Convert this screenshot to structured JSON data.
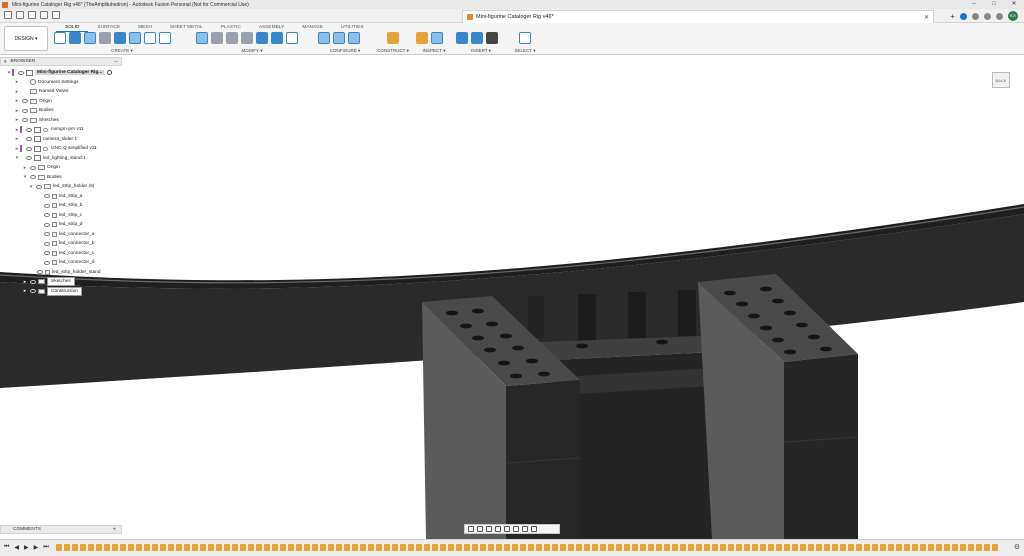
{
  "window": {
    "title": "Mini-figurine Cataloger Rig v46* (TheAmplituhedron) - Autodesk Fusion Personal (Not for Commercial Use)",
    "controls": [
      "–",
      "□",
      "✕"
    ]
  },
  "document_tab": {
    "title": "Mini-figurine Cataloger Rig v46*",
    "close": "✕"
  },
  "user": {
    "initials": "KA"
  },
  "workspace": {
    "label": "DESIGN ▾"
  },
  "ribbon": {
    "tabs": [
      "SOLID",
      "SURFACE",
      "MESH",
      "SHEET METAL",
      "PLASTIC",
      "ASSEMBLY",
      "MANAGE",
      "UTILITIES"
    ],
    "active_tab": "SOLID",
    "groups": [
      "CREATE ▾",
      "MODIFY ▾",
      "CONFIGURE ▾",
      "CONSTRUCT ▾",
      "INSPECT ▾",
      "INSERT ▾",
      "SELECT ▾"
    ]
  },
  "browser": {
    "title": "BROWSER",
    "root": "Mini-figurine Cataloger Rig...",
    "items": [
      "Document Settings",
      "Named Views",
      "Origin",
      "Bodies",
      "Sketches",
      "mimgm-pm v11",
      "camera_slider:1",
      "UNO Q simplified v11",
      "led_lighting_stand:1",
      "Origin",
      "Bodies",
      "led_strip_holder (8)",
      "led_strip_a",
      "led_strip_b",
      "led_strip_c",
      "led_strip_d",
      "led_connector_a",
      "led_connector_b",
      "led_connector_c",
      "led_connector_d",
      "led_strip_holder_stand",
      "Sketches",
      "Construction"
    ]
  },
  "viewcube": {
    "face": "BACK"
  },
  "comments": {
    "title": "COMMENTS",
    "add": "+"
  },
  "colors": {
    "accent": "#1e72c8",
    "body_dark": "#2b2b2b",
    "body_grey": "#5c5c5c",
    "viewport_bg": "#ffffff"
  }
}
